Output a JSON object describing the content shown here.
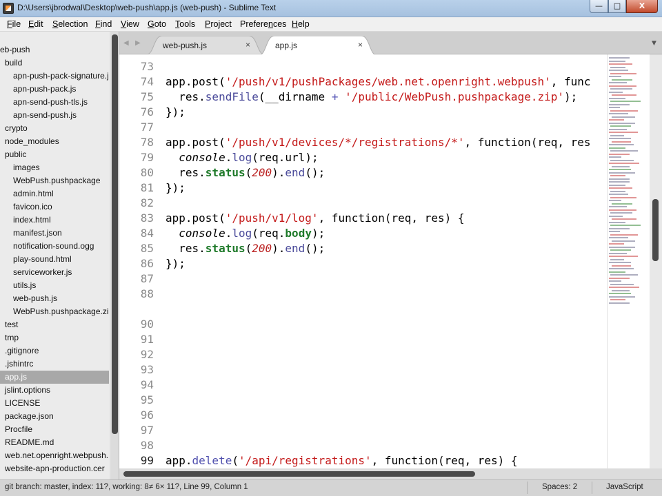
{
  "window": {
    "title": "D:\\Users\\jbrodwal\\Desktop\\web-push\\app.js (web-push) - Sublime Text",
    "min_glyph": "—",
    "max_glyph": "□",
    "close_glyph": "X"
  },
  "menu": [
    {
      "label": "File",
      "u": "F",
      "rest": "ile"
    },
    {
      "label": "Edit",
      "u": "E",
      "rest": "dit"
    },
    {
      "label": "Selection",
      "u": "S",
      "rest": "election"
    },
    {
      "label": "Find",
      "u": "F",
      "rest": "ind"
    },
    {
      "label": "View",
      "u": "V",
      "rest": "iew"
    },
    {
      "label": "Goto",
      "u": "G",
      "rest": "oto"
    },
    {
      "label": "Tools",
      "u": "T",
      "rest": "ools"
    },
    {
      "label": "Project",
      "u": "P",
      "rest": "roject"
    },
    {
      "label": "Preferences",
      "u": "n",
      "pre": "Prefere",
      "rest": "ces"
    },
    {
      "label": "Help",
      "u": "H",
      "rest": "elp"
    }
  ],
  "sidebar": {
    "items": [
      {
        "label": "eb-push",
        "level": 0
      },
      {
        "label": "build",
        "level": 1
      },
      {
        "label": "apn-push-pack-signature.js",
        "level": 2
      },
      {
        "label": "apn-push-pack.js",
        "level": 2
      },
      {
        "label": "apn-send-push-tls.js",
        "level": 2
      },
      {
        "label": "apn-send-push.js",
        "level": 2
      },
      {
        "label": "crypto",
        "level": 1
      },
      {
        "label": "node_modules",
        "level": 1
      },
      {
        "label": "public",
        "level": 1
      },
      {
        "label": "images",
        "level": 2
      },
      {
        "label": "WebPush.pushpackage",
        "level": 2
      },
      {
        "label": "admin.html",
        "level": 2
      },
      {
        "label": "favicon.ico",
        "level": 2
      },
      {
        "label": "index.html",
        "level": 2
      },
      {
        "label": "manifest.json",
        "level": 2
      },
      {
        "label": "notification-sound.ogg",
        "level": 2
      },
      {
        "label": "play-sound.html",
        "level": 2
      },
      {
        "label": "serviceworker.js",
        "level": 2
      },
      {
        "label": "utils.js",
        "level": 2
      },
      {
        "label": "web-push.js",
        "level": 2
      },
      {
        "label": "WebPush.pushpackage.zip",
        "level": 2
      },
      {
        "label": "test",
        "level": 1
      },
      {
        "label": "tmp",
        "level": 1
      },
      {
        "label": ".gitignore",
        "level": 1
      },
      {
        "label": ".jshintrc",
        "level": 1
      },
      {
        "label": "app.js",
        "level": 1,
        "selected": true
      },
      {
        "label": "jslint.options",
        "level": 1
      },
      {
        "label": "LICENSE",
        "level": 1
      },
      {
        "label": "package.json",
        "level": 1
      },
      {
        "label": "Procfile",
        "level": 1
      },
      {
        "label": "README.md",
        "level": 1
      },
      {
        "label": "web.net.openright.webpush.",
        "level": 1
      },
      {
        "label": "website-apn-production.cer",
        "level": 1
      }
    ]
  },
  "tabs": {
    "nav_left": "◀",
    "nav_right": "▶",
    "close_glyph": "×",
    "dropdown_glyph": "▼",
    "items": [
      {
        "label": "web-push.js",
        "active": false
      },
      {
        "label": "app.js",
        "active": true
      }
    ]
  },
  "editor": {
    "lines": [
      {
        "n": "73",
        "code": ""
      },
      {
        "n": "74",
        "code": "app.post('/push/v1/pushPackages/web.net.openright.webpush', func"
      },
      {
        "n": "75",
        "code": "  res.sendFile(__dirname + '/public/WebPush.pushpackage.zip');"
      },
      {
        "n": "76",
        "code": "});"
      },
      {
        "n": "77",
        "code": ""
      },
      {
        "n": "78",
        "code": "app.post('/push/v1/devices/*/registrations/*', function(req, res"
      },
      {
        "n": "79",
        "code": "  console.log(req.url);"
      },
      {
        "n": "80",
        "code": "  res.status(200).end();"
      },
      {
        "n": "81",
        "code": "});"
      },
      {
        "n": "82",
        "code": ""
      },
      {
        "n": "83",
        "code": "app.post('/push/v1/log', function(req, res) {"
      },
      {
        "n": "84",
        "code": "  console.log(req.body);"
      },
      {
        "n": "85",
        "code": "  res.status(200).end();"
      },
      {
        "n": "86",
        "code": "});"
      },
      {
        "n": "87",
        "code": ""
      },
      {
        "n": "88",
        "code": ""
      },
      {
        "n": "90",
        "code": ""
      },
      {
        "n": "91",
        "code": ""
      },
      {
        "n": "92",
        "code": ""
      },
      {
        "n": "93",
        "code": ""
      },
      {
        "n": "94",
        "code": ""
      },
      {
        "n": "95",
        "code": ""
      },
      {
        "n": "96",
        "code": ""
      },
      {
        "n": "97",
        "code": ""
      },
      {
        "n": "98",
        "code": ""
      },
      {
        "n": "99",
        "code": "app.delete('/api/registrations', function(req, res) {",
        "active": true
      }
    ]
  },
  "status": {
    "left": "git branch: master, index: 11?, working: 8≠ 6× 11?, Line 99, Column 1",
    "spaces": "Spaces: 2",
    "syntax": "JavaScript"
  },
  "colors": {
    "string": "#c41a1a",
    "builtin": "#1f7a2a",
    "sidebar_selected": "#a8a8a8"
  }
}
